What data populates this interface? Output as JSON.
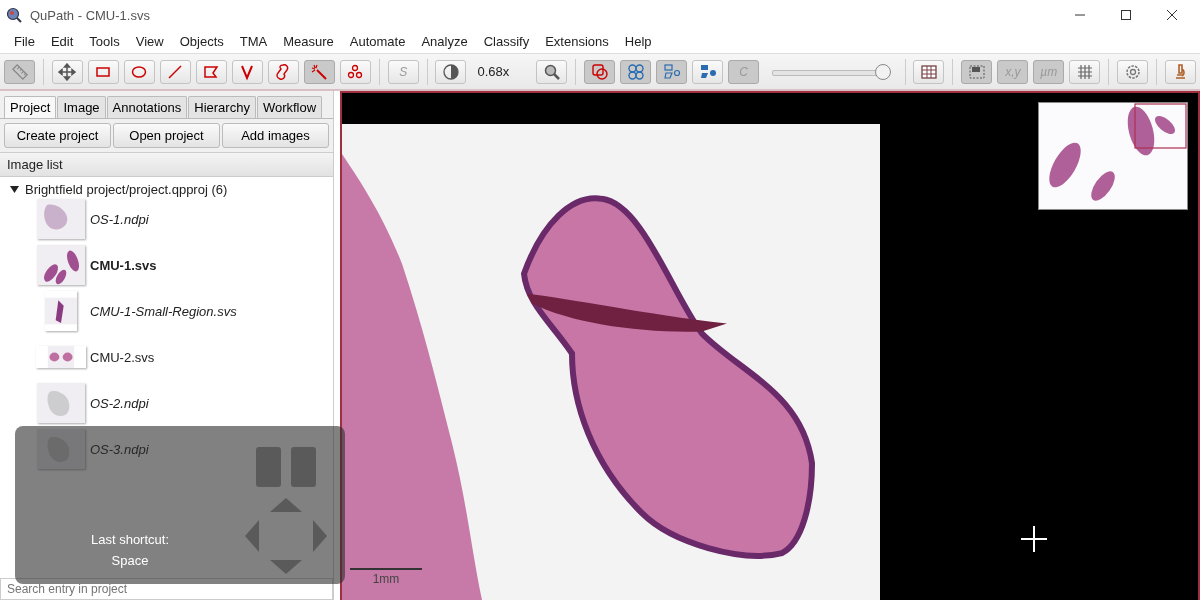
{
  "window": {
    "title": "QuPath - CMU-1.svs"
  },
  "menu": [
    "File",
    "Edit",
    "Tools",
    "View",
    "Objects",
    "TMA",
    "Measure",
    "Automate",
    "Analyze",
    "Classify",
    "Extensions",
    "Help"
  ],
  "toolbar": [
    [
      {
        "kind": "icon",
        "selected": true
      }
    ],
    [
      {
        "kind": "icon",
        "selected": false
      },
      {
        "kind": "icon",
        "selected": false
      },
      {
        "kind": "icon",
        "selected": false
      },
      {
        "kind": "icon",
        "selected": false
      },
      {
        "kind": "icon",
        "selected": false
      },
      {
        "kind": "icon",
        "selected": false
      },
      {
        "kind": "icon",
        "selected": false
      },
      {
        "kind": "icon",
        "selected": true
      },
      {
        "kind": "icon",
        "selected": false
      }
    ],
    [
      {
        "kind": "text",
        "label": "S",
        "selected": false,
        "disabled": true
      }
    ],
    [
      {
        "kind": "icon",
        "selected": false
      },
      {
        "kind": "label",
        "label": "0.68x"
      },
      {
        "kind": "icon",
        "selected": false
      }
    ],
    [
      {
        "kind": "icon",
        "selected": true
      },
      {
        "kind": "icon",
        "selected": true
      },
      {
        "kind": "icon",
        "selected": true
      },
      {
        "kind": "icon",
        "selected": false
      },
      {
        "kind": "text",
        "label": "C",
        "selected": true,
        "disabled": true
      },
      {
        "kind": "slider",
        "level": 1.0
      }
    ],
    [
      {
        "kind": "icon",
        "selected": false
      }
    ],
    [
      {
        "kind": "icon",
        "selected": true
      },
      {
        "kind": "text",
        "label": "x,y",
        "selected": true,
        "disabled": true
      },
      {
        "kind": "text",
        "label": "µm",
        "selected": true,
        "disabled": true
      },
      {
        "kind": "icon",
        "selected": false
      }
    ],
    [
      {
        "kind": "icon",
        "selected": false
      }
    ],
    [
      {
        "kind": "icon",
        "selected": false
      }
    ]
  ],
  "tabs": [
    {
      "label": "Project",
      "selected": true
    },
    {
      "label": "Image",
      "selected": false
    },
    {
      "label": "Annotations",
      "selected": false
    },
    {
      "label": "Hierarchy",
      "selected": false
    },
    {
      "label": "Workflow",
      "selected": false
    }
  ],
  "project_buttons": [
    "Create project",
    "Open project",
    "Add images"
  ],
  "image_list": {
    "title": "Image list",
    "root": {
      "label": "Brightfield project/project.qpproj (6)",
      "expanded": true,
      "children": [
        {
          "name": "OS-1.ndpi",
          "selected": false,
          "italic": true
        },
        {
          "name": "CMU-1.svs",
          "selected": true,
          "italic": false
        },
        {
          "name": "CMU-1-Small-Region.svs",
          "selected": false,
          "italic": true
        },
        {
          "name": "CMU-2.svs",
          "selected": false,
          "italic": false
        },
        {
          "name": "OS-2.ndpi",
          "selected": false,
          "italic": true
        },
        {
          "name": "OS-3.ndpi",
          "selected": false,
          "italic": true
        }
      ]
    }
  },
  "search": {
    "placeholder": "Search entry in project"
  },
  "shortcut_overlay": {
    "title": "Last shortcut:",
    "key": "Space"
  },
  "viewer": {
    "scale_bar": "1mm"
  }
}
